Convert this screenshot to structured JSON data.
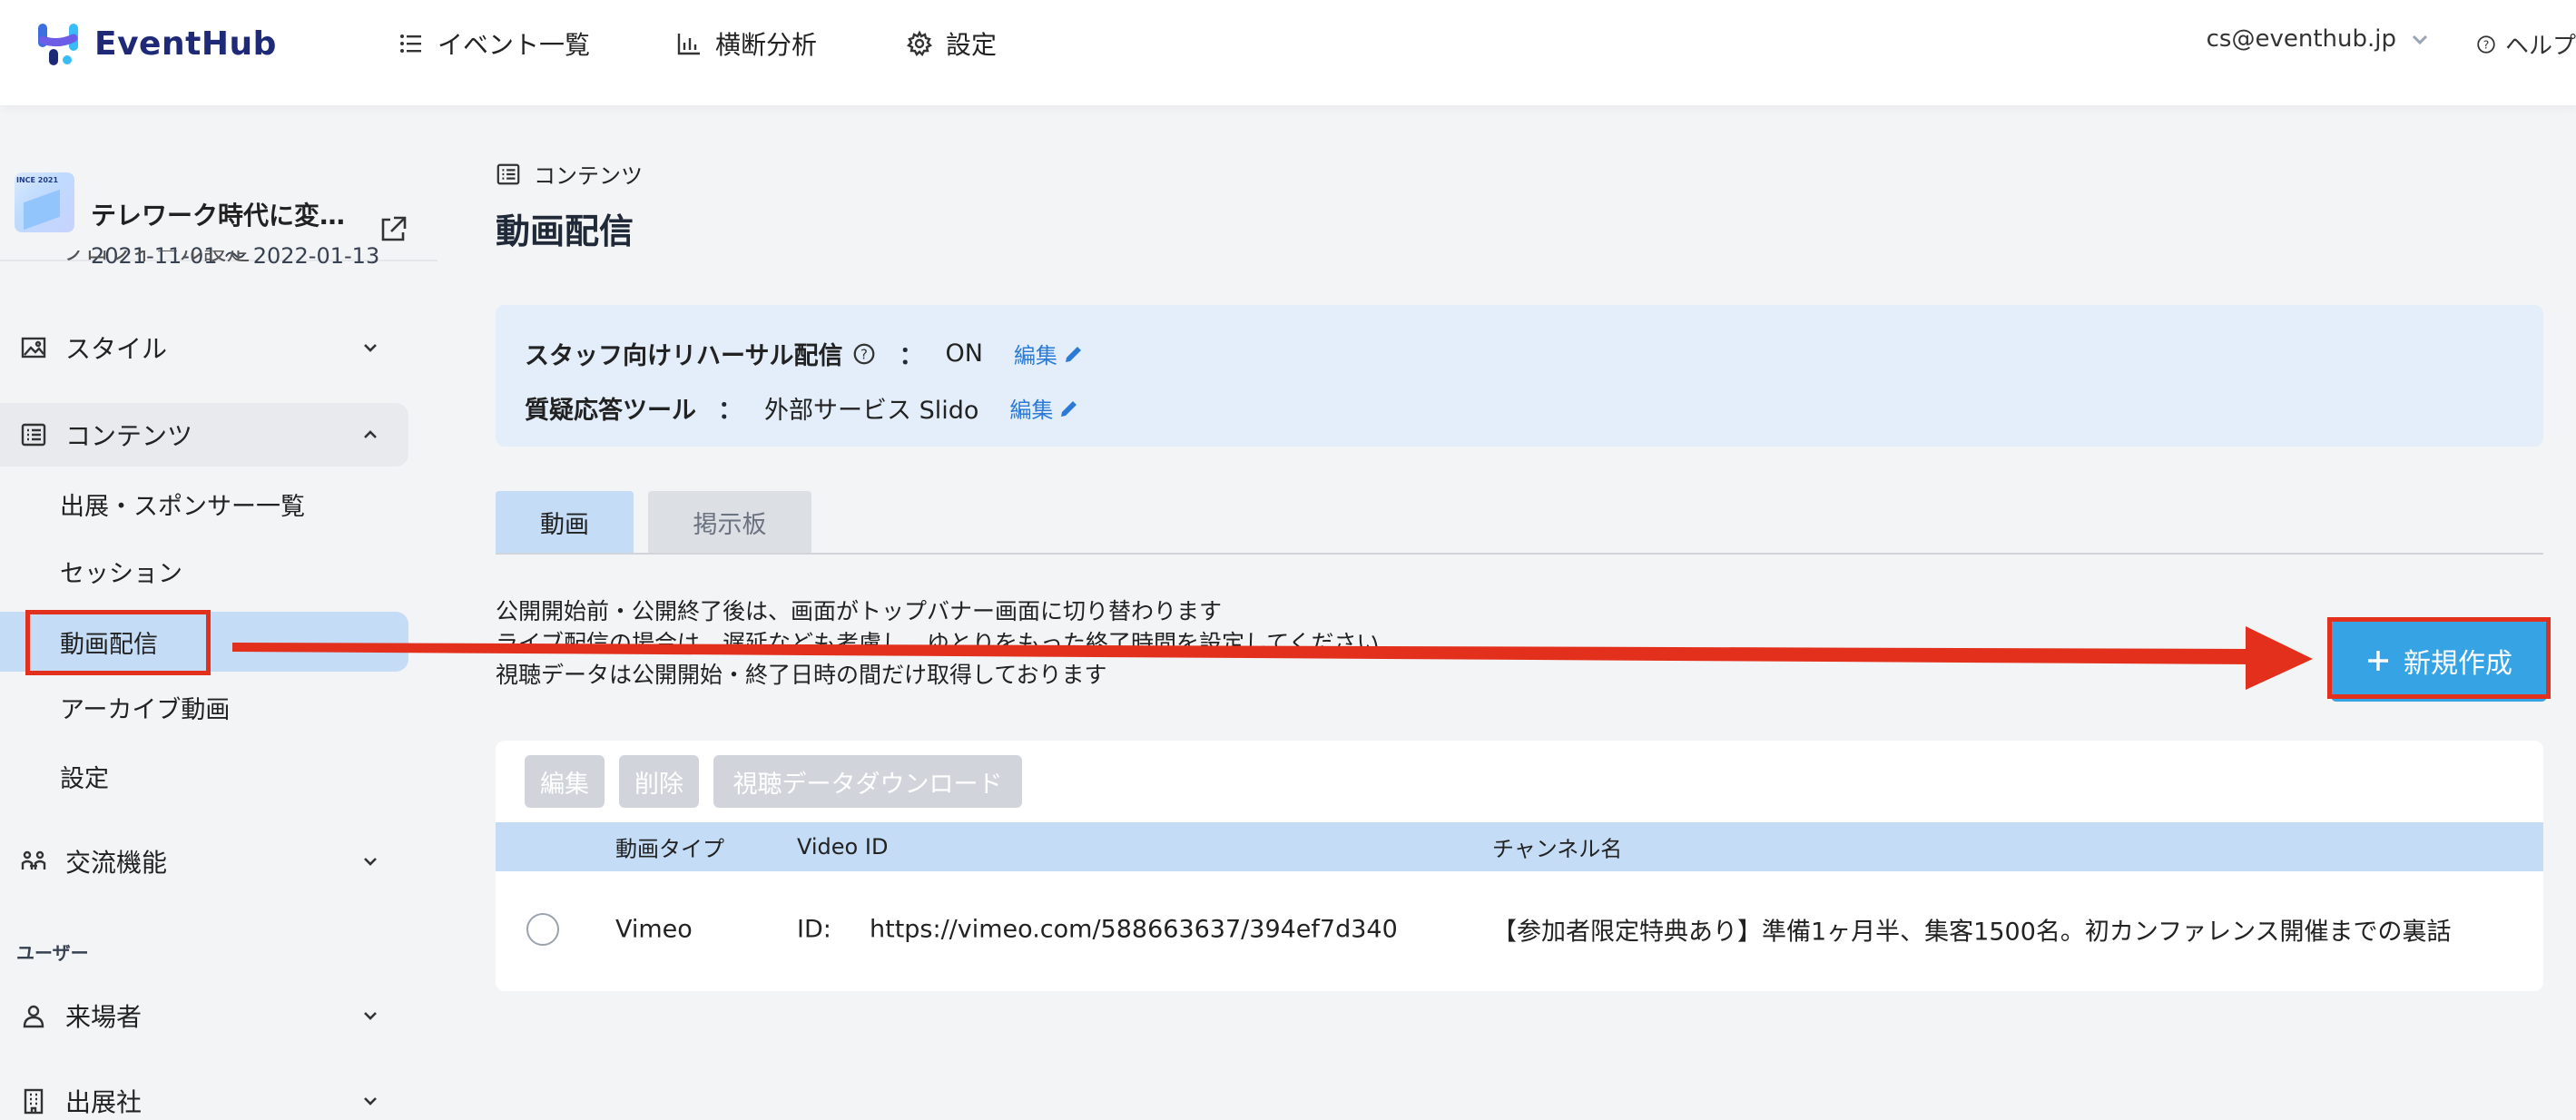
{
  "header": {
    "logo_text": "EventHub",
    "nav": [
      {
        "label": "イベント一覧",
        "icon": "list-icon"
      },
      {
        "label": "横断分析",
        "icon": "bar-chart-icon"
      },
      {
        "label": "設定",
        "icon": "gear-icon"
      }
    ],
    "account_email": "cs@eventhub.jp",
    "help_label": "ヘルプ"
  },
  "sidebar": {
    "event_title": "テレワーク時代に変…",
    "event_dates": "2021-11-01 〜 2022-01-13",
    "event_thumb_text": "INCE 2021",
    "partial_item": "プロフィール設定",
    "style_label": "スタイル",
    "contents_label": "コンテンツ",
    "contents_children": [
      {
        "label": "出展・スポンサー一覧"
      },
      {
        "label": "セッション"
      },
      {
        "label": "動画配信"
      },
      {
        "label": "アーカイブ動画"
      },
      {
        "label": "設定"
      }
    ],
    "exchange_label": "交流機能",
    "users_section": "ユーザー",
    "visitors_label": "来場者",
    "exhibitors_label": "出展社"
  },
  "main": {
    "breadcrumb": "コンテンツ",
    "title": "動画配信",
    "settings": {
      "rehearsal_key": "スタッフ向けリハーサル配信",
      "rehearsal_value": "ON",
      "qa_key": "質疑応答ツール",
      "qa_value": "外部サービス Slido",
      "colon": "：",
      "edit_label": "編集"
    },
    "tabs": [
      {
        "label": "動画",
        "active": true
      },
      {
        "label": "掲示板",
        "active": false
      }
    ],
    "notes": [
      "公開開始前・公開終了後は、画面がトップバナー画面に切り替わります",
      "ライブ配信の場合は、遅延なども考慮し、ゆとりをもった終了時間を設定してください",
      "視聴データは公開開始・終了日時の間だけ取得しております"
    ],
    "new_button_label": "新規作成",
    "toolbar": {
      "edit": "編集",
      "delete": "削除",
      "download": "視聴データダウンロード"
    },
    "table": {
      "columns": [
        "動画タイプ",
        "Video ID",
        "チャンネル名"
      ],
      "rows": [
        {
          "type": "Vimeo",
          "id_prefix": "ID:",
          "video_id": "https://vimeo.com/588663637/394ef7d340",
          "channel": "【参加者限定特典あり】準備1ヶ月半、集客1500名。初カンファレンス開催までの裏話"
        }
      ]
    }
  },
  "colors": {
    "accent_blue": "#36a3e4",
    "active_bg": "#c4dcf6",
    "annotation_red": "#e3301c",
    "link_blue": "#2b7bd6"
  }
}
